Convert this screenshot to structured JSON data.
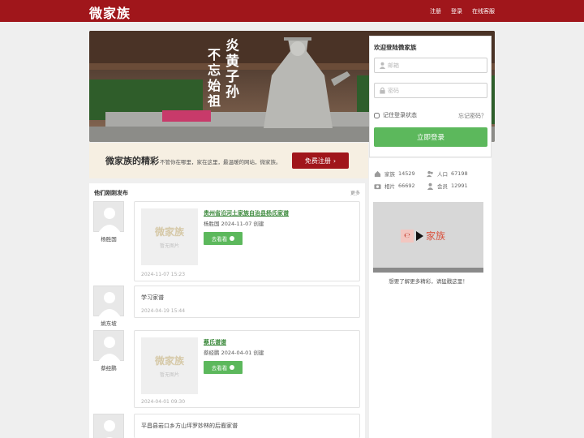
{
  "header": {
    "logo": "微家族",
    "nav": [
      "注册",
      "登录",
      "在线客服"
    ]
  },
  "banner": {
    "calligraphy_1": "炎黄子孙",
    "calligraphy_2": "不忘始祖"
  },
  "promo": {
    "title": "微家族的精彩",
    "subtitle": "不管你在哪里，家在这里，最温暖的网站，微家族。",
    "button": "免费注册"
  },
  "login": {
    "title": "欢迎登陆微家族",
    "email_placeholder": "邮箱",
    "password_placeholder": "密码",
    "remember": "记住登录状态",
    "forgot": "忘记密码？",
    "submit": "立即登录"
  },
  "stats": {
    "family_label": "家族",
    "family_value": "14529",
    "population_label": "人口",
    "population_value": "67198",
    "photos_label": "相片",
    "photos_value": "66692",
    "members_label": "会员",
    "members_value": "12991"
  },
  "video": {
    "brand": "家族",
    "caption": "想要了解更多精彩，请猛戳这里！"
  },
  "feed": {
    "title": "他们刚刚发布",
    "more": "更多",
    "thumb_logo": "微家族",
    "thumb_placeholder": "暂无图片",
    "view_label": "去看看",
    "posts": [
      {
        "user": "杨胜国",
        "title": "贵州省沿河土家族自治县杨氏家谱",
        "meta": "杨胜国 2024-11-07 创建",
        "date": "2024-11-07 15:23"
      },
      {
        "user": "姚东坡",
        "text": "学习家谱",
        "date": "2024-04-19 15:44"
      },
      {
        "user": "蔡经鹏",
        "title": "蔡氏谱谱",
        "meta": "蔡经鹏 2024-04-01 创建",
        "date": "2024-04-01 09:30"
      },
      {
        "user": "",
        "text": "平昌县岩口乡方山坪罗妙林的后裔家谱",
        "date": ""
      }
    ]
  },
  "colors": {
    "brand_red": "#a0161b",
    "green": "#5cb85c",
    "link_green": "#3d8a3d"
  }
}
